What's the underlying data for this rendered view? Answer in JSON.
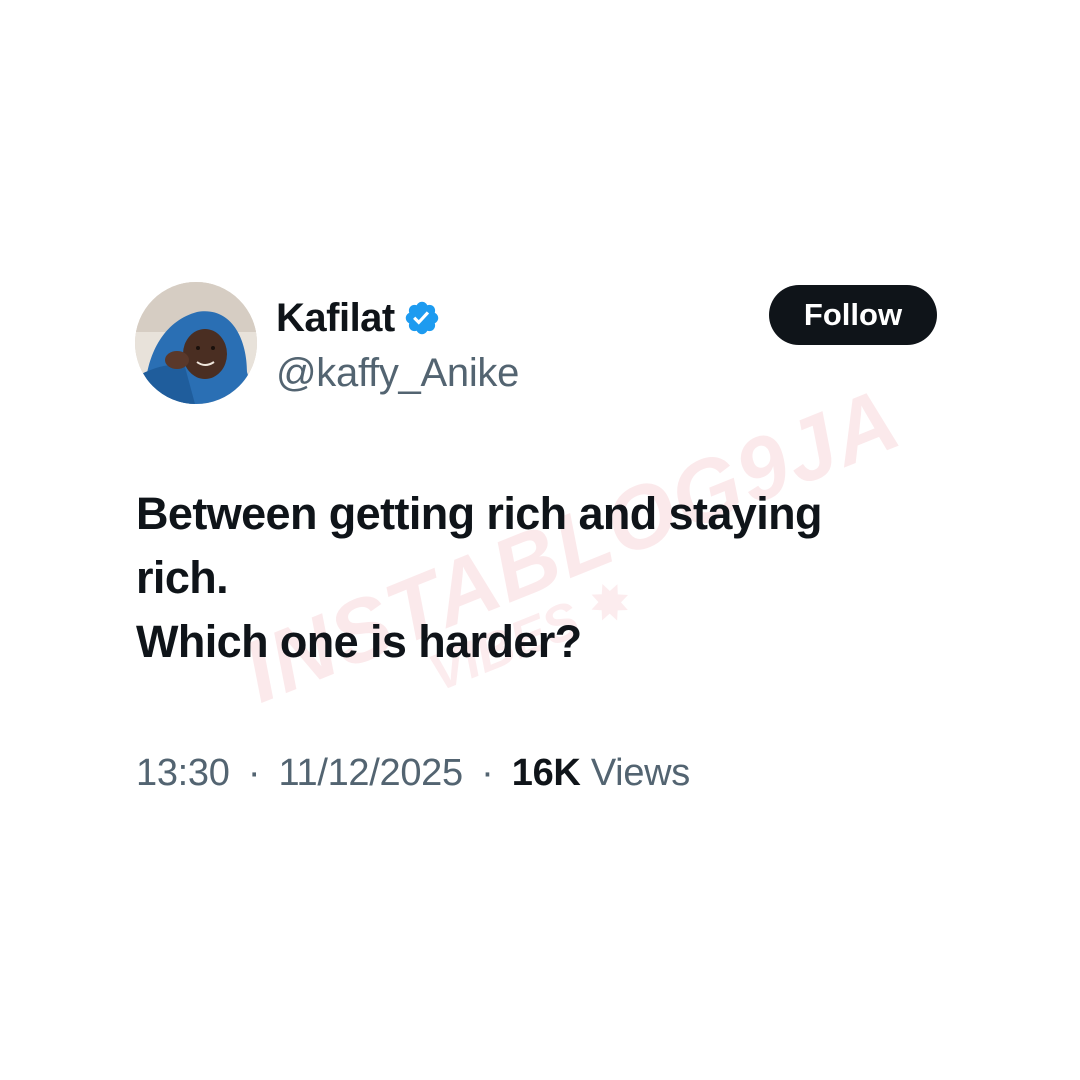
{
  "author": {
    "display_name": "Kafilat",
    "handle": "@kaffy_Anike",
    "verified": true,
    "avatar": "avatar-photo"
  },
  "follow_button": {
    "label": "Follow"
  },
  "tweet": {
    "lines": [
      "Between getting rich and staying",
      "rich.",
      "Which one is harder?"
    ]
  },
  "meta": {
    "time": "13:30",
    "separator": "·",
    "date": "11/12/2025",
    "views_count": "16K",
    "views_label": "Views"
  },
  "watermark": {
    "main": "INSTABLOG9JA",
    "sub": "VIBES"
  },
  "colors": {
    "text_primary": "#0f1419",
    "text_secondary": "#536471",
    "verified_blue": "#1d9bf0",
    "button_bg": "#0f1419",
    "button_text": "#ffffff",
    "watermark": "#e87884"
  }
}
